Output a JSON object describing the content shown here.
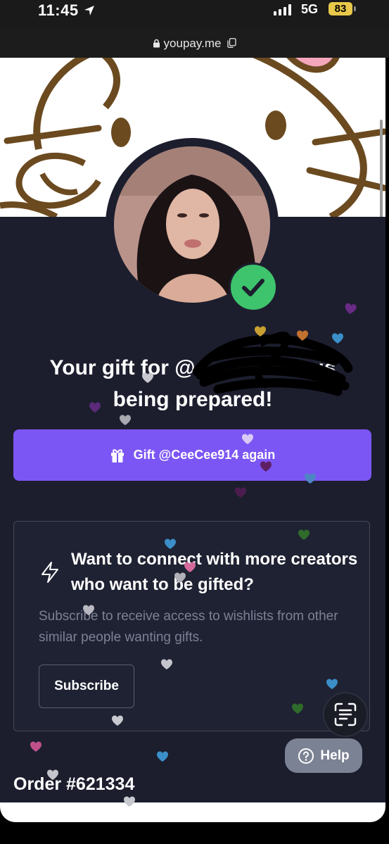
{
  "status_bar": {
    "time": "11:45",
    "network": "5G",
    "battery": "83"
  },
  "browser": {
    "url": "youpay.me"
  },
  "page": {
    "title_line1": "Your gift for @",
    "title_line1_tail": "is",
    "title_line2": "being prepared!",
    "gift_button_label": "Gift @CeeCee914 again",
    "card": {
      "title": "Want to connect with more creators who want to be gifted?",
      "text": "Subscribe to receive access to wishlists from other similar people wanting gifts.",
      "subscribe_label": "Subscribe"
    },
    "order_label": "Order #621334",
    "help_label": "Help"
  },
  "colors": {
    "accent": "#7c56f4",
    "background": "#1c1e2e",
    "verified": "#3ec46d"
  }
}
